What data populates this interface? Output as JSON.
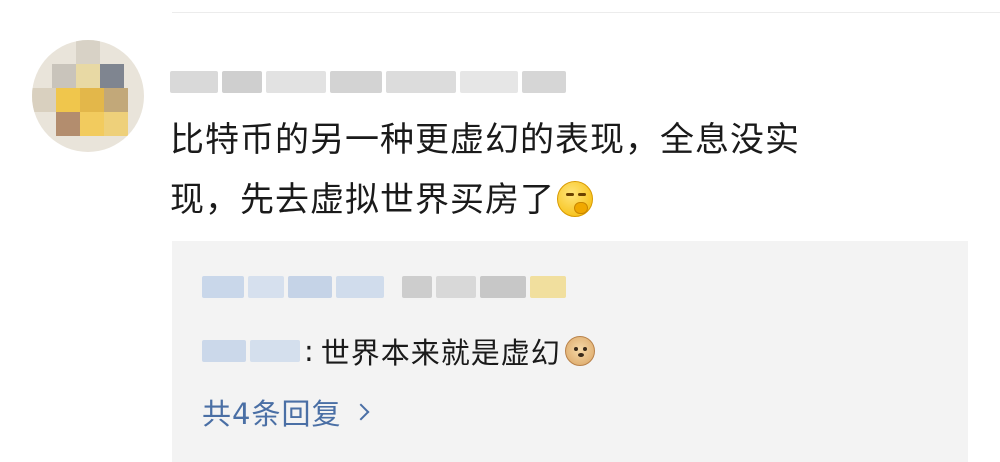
{
  "comment": {
    "text_line1": "比特币的另一种更虚幻的表现，全息没实",
    "text_line2": "现，先去虚拟世界买房了",
    "emoji": "thinking-emoji"
  },
  "reply": {
    "separator": ":",
    "text": "世界本来就是虚幻",
    "emoji": "doge-emoji"
  },
  "more_replies": {
    "label": "共4条回复",
    "icon": "chevron-right-icon"
  },
  "colors": {
    "link": "#4a6fa5",
    "reply_background": "#f3f3f3",
    "text": "#1a1a1a"
  }
}
